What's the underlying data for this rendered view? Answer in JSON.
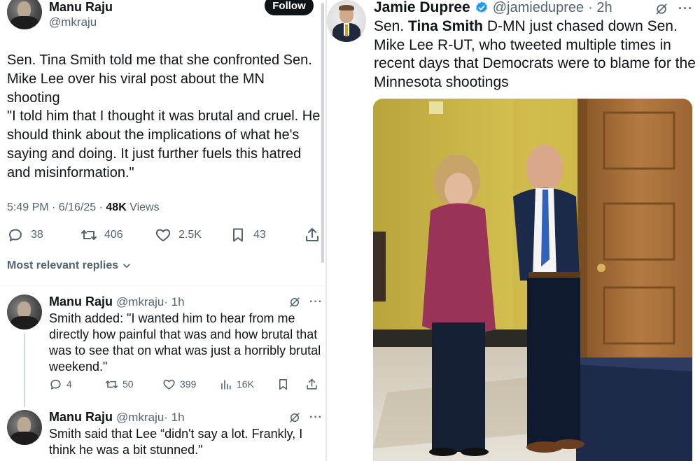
{
  "left_panel": {
    "main_tweet": {
      "author_name": "Manu Raju",
      "author_handle": "@mkraju",
      "follow_label": "Follow",
      "paragraph_1": "Sen. Tina Smith told me that she confronted Sen. Mike Lee over his viral post about the MN shooting",
      "paragraph_2": "\"I told him that I thought it was brutal and cruel. He should think about the implications of what he's saying and doing. It just further fuels this hatred and misinformation.\"",
      "time": "5:49 PM · 6/16/25 · ",
      "views_count": "48K",
      "views_label": " Views",
      "actions": {
        "replies": "38",
        "reposts": "406",
        "likes": "2.5K",
        "bookmarks": "43"
      }
    },
    "most_relevant_label": "Most relevant replies",
    "replies": [
      {
        "author_name": "Manu Raju",
        "author_handle": "@mkraju",
        "age": "· 1h",
        "text": "Smith added: \"I wanted him to hear from me directly how painful that was and how brutal that was to see that on what was just a horribly brutal weekend.\"",
        "actions": {
          "replies": "4",
          "reposts": "50",
          "likes": "399",
          "views": "16K"
        }
      },
      {
        "author_name": "Manu Raju",
        "author_handle": "@mkraju",
        "age": "· 1h",
        "text": "Smith said that Lee “didn't say a lot. Frankly, I think he was a bit stunned.\""
      }
    ]
  },
  "right_panel": {
    "author_name": "Jamie Dupree",
    "author_handle": "@jamiedupree",
    "age": "· 2h",
    "text_prefix": "Sen. ",
    "text_bold": "Tina Smith",
    "text_suffix": " D-MN just chased down Sen. Mike Lee R-UT, who tweeted multiple times in recent days that Democrats were to blame for the Minnesota shootings"
  },
  "icons": {
    "reply": "reply-icon",
    "repost": "repost-icon",
    "like": "heart-icon",
    "bookmark": "bookmark-icon",
    "share": "share-icon",
    "views": "views-icon",
    "grok": "grok-icon",
    "more": "more-icon",
    "verified": "verified-badge-icon",
    "chevron": "chevron-down-icon"
  },
  "colors": {
    "text_primary": "#0f1419",
    "text_secondary": "#536471",
    "verified_blue": "#1d9bf0",
    "follow_bg": "#0f1419"
  }
}
